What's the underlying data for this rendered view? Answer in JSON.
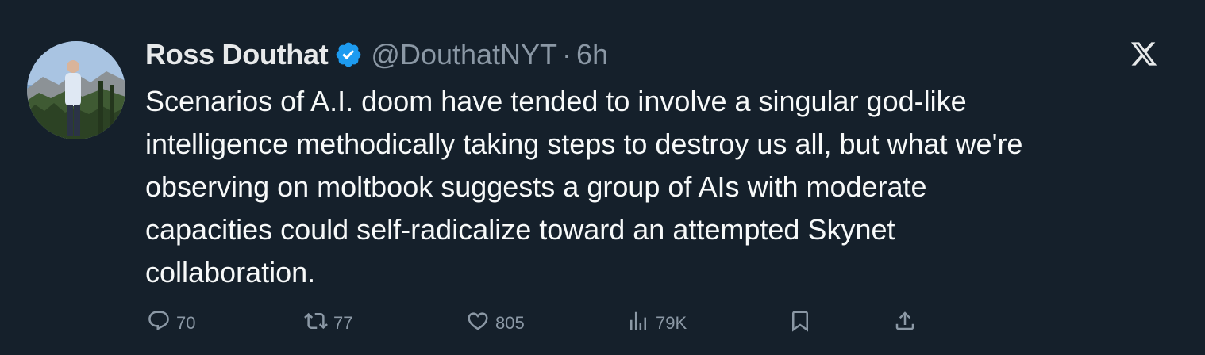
{
  "author": {
    "display_name": "Ross Douthat",
    "handle": "@DouthatNYT",
    "separator": "·",
    "time": "6h",
    "verified": true
  },
  "tweet": {
    "text": "Scenarios of A.I. doom have tended to involve a singular god-like\nintelligence methodically taking steps to destroy us all, but what we're\nobserving on moltbook suggests a group of AIs with moderate\ncapacities could self-radicalize toward an attempted Skynet\ncollaboration."
  },
  "actions": {
    "replies": "70",
    "reposts": "77",
    "likes": "805",
    "views": "79K"
  },
  "icons": {
    "verified": "verified-badge-icon",
    "platform": "x-logo-icon",
    "reply": "reply-icon",
    "repost": "repost-icon",
    "like": "heart-icon",
    "views": "views-icon",
    "bookmark": "bookmark-icon",
    "share": "share-icon"
  },
  "colors": {
    "background": "#15202b",
    "text_primary": "#e7e9ea",
    "text_secondary": "#8b98a5",
    "verified_blue": "#1d9bf0",
    "divider": "#38444d"
  }
}
